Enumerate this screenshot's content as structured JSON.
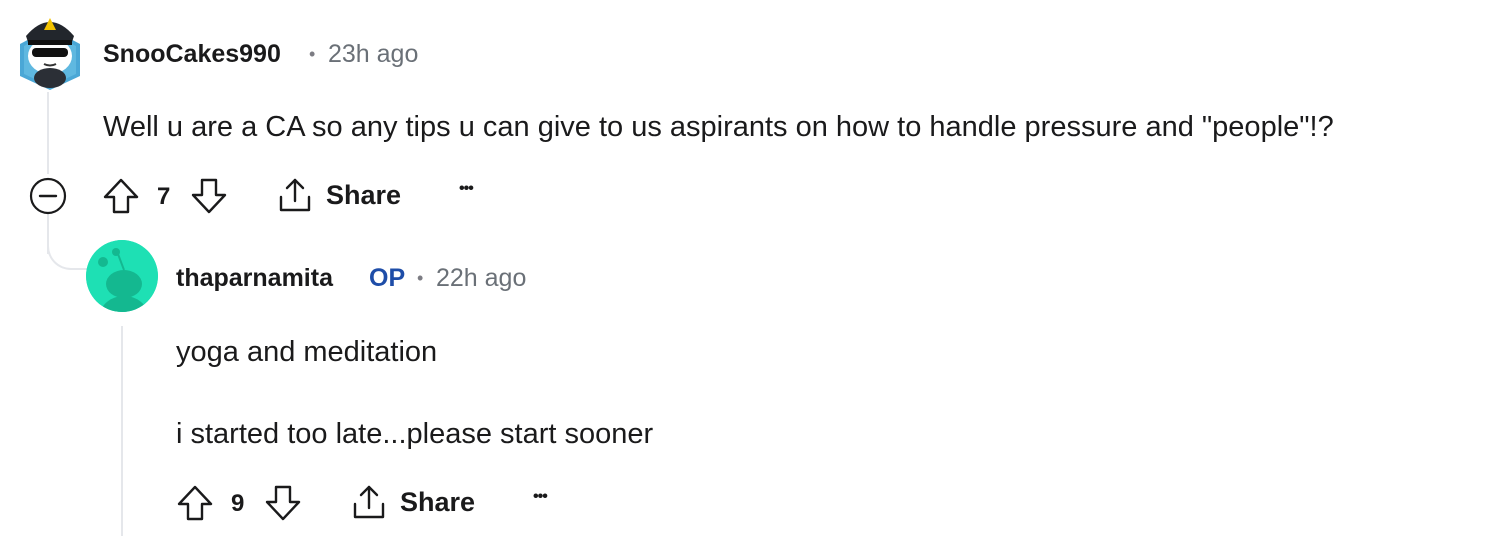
{
  "comments": [
    {
      "username": "SnooCakes990",
      "separator": "•",
      "time": "23h ago",
      "body": "Well u are a CA so any tips u can give to us aspirants on how to handle pressure and \"people\"!?",
      "votes": "7",
      "share_label": "Share",
      "more_label": "•••"
    },
    {
      "username": "thaparnamita",
      "op_badge": "OP",
      "separator": "•",
      "time": "22h ago",
      "body_lines": [
        "yoga and meditation",
        "i started too late...please start sooner"
      ],
      "votes": "9",
      "share_label": "Share",
      "more_label": "•••"
    }
  ],
  "colors": {
    "op_badge": "#1e4da8",
    "reply_avatar_bg": "#1ee0b4",
    "thread_line": "#e5e7eb"
  },
  "icons": [
    "collapse-minus-icon",
    "upvote-icon",
    "downvote-icon",
    "share-icon",
    "more-options-icon",
    "user-avatar-icon",
    "snoo-avatar-icon"
  ]
}
